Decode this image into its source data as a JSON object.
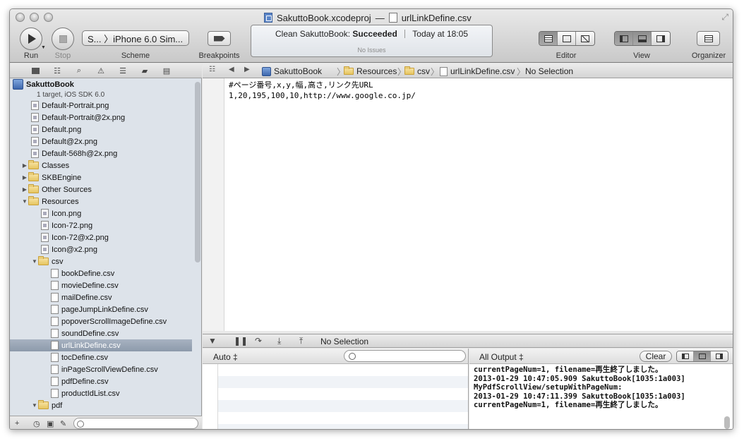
{
  "window": {
    "project_file": "SakuttoBook.xcodeproj",
    "title_separator": "—",
    "open_file": "urlLinkDefine.csv"
  },
  "toolbar": {
    "run_label": "Run",
    "stop_label": "Stop",
    "scheme_value": "S... 〉iPhone 6.0 Sim...",
    "scheme_label": "Scheme",
    "breakpoints_label": "Breakpoints",
    "editor_label": "Editor",
    "view_label": "View",
    "organizer_label": "Organizer"
  },
  "activity": {
    "action": "Clean SakuttoBook:",
    "result": "Succeeded",
    "time": "Today at 18:05",
    "issues": "No Issues"
  },
  "navigator": {
    "items": [
      {
        "label": "SakuttoBook",
        "type": "project",
        "indent": 0,
        "disclosure": "▼"
      },
      {
        "label": "1 target, iOS SDK 6.0",
        "type": "subtitle",
        "indent": 0,
        "disclosure": ""
      },
      {
        "label": "Default-Portrait.png",
        "type": "image",
        "indent": 1,
        "disclosure": ""
      },
      {
        "label": "Default-Portrait@2x.png",
        "type": "image",
        "indent": 1,
        "disclosure": ""
      },
      {
        "label": "Default.png",
        "type": "image",
        "indent": 1,
        "disclosure": ""
      },
      {
        "label": "Default@2x.png",
        "type": "image",
        "indent": 1,
        "disclosure": ""
      },
      {
        "label": "Default-568h@2x.png",
        "type": "image",
        "indent": 1,
        "disclosure": ""
      },
      {
        "label": "Classes",
        "type": "folder",
        "indent": 1,
        "disclosure": "▶"
      },
      {
        "label": "SKBEngine",
        "type": "folder",
        "indent": 1,
        "disclosure": "▶"
      },
      {
        "label": "Other Sources",
        "type": "folder",
        "indent": 1,
        "disclosure": "▶"
      },
      {
        "label": "Resources",
        "type": "folder",
        "indent": 1,
        "disclosure": "▼"
      },
      {
        "label": "Icon.png",
        "type": "image",
        "indent": 2,
        "disclosure": ""
      },
      {
        "label": "Icon-72.png",
        "type": "image",
        "indent": 2,
        "disclosure": ""
      },
      {
        "label": "Icon-72@x2.png",
        "type": "image",
        "indent": 2,
        "disclosure": ""
      },
      {
        "label": "Icon@x2.png",
        "type": "image",
        "indent": 2,
        "disclosure": ""
      },
      {
        "label": "csv",
        "type": "folder",
        "indent": 2,
        "disclosure": "▼"
      },
      {
        "label": "bookDefine.csv",
        "type": "file",
        "indent": 3,
        "disclosure": ""
      },
      {
        "label": "movieDefine.csv",
        "type": "file",
        "indent": 3,
        "disclosure": ""
      },
      {
        "label": "mailDefine.csv",
        "type": "file",
        "indent": 3,
        "disclosure": ""
      },
      {
        "label": "pageJumpLinkDefine.csv",
        "type": "file",
        "indent": 3,
        "disclosure": ""
      },
      {
        "label": "popoverScrollImageDefine.csv",
        "type": "file",
        "indent": 3,
        "disclosure": ""
      },
      {
        "label": "soundDefine.csv",
        "type": "file",
        "indent": 3,
        "disclosure": ""
      },
      {
        "label": "urlLinkDefine.csv",
        "type": "file",
        "indent": 3,
        "disclosure": "",
        "selected": true
      },
      {
        "label": "tocDefine.csv",
        "type": "file",
        "indent": 3,
        "disclosure": ""
      },
      {
        "label": "inPageScrollViewDefine.csv",
        "type": "file",
        "indent": 3,
        "disclosure": ""
      },
      {
        "label": "pdfDefine.csv",
        "type": "file",
        "indent": 3,
        "disclosure": ""
      },
      {
        "label": "productIdList.csv",
        "type": "file",
        "indent": 3,
        "disclosure": ""
      },
      {
        "label": "pdf",
        "type": "folder",
        "indent": 2,
        "disclosure": "▼"
      }
    ]
  },
  "jumpbar": {
    "crumbs": [
      "SakuttoBook",
      "Resources",
      "csv",
      "urlLinkDefine.csv",
      "No Selection"
    ]
  },
  "editor": {
    "lines": [
      "#ページ番号,x,y,幅,高さ,リンク先URL",
      "1,20,195,100,10,http://www.google.co.jp/"
    ]
  },
  "debug": {
    "status": "No Selection"
  },
  "variables": {
    "scope": "Auto ‡"
  },
  "console": {
    "filter": "All Output ‡",
    "clear_label": "Clear",
    "output": "currentPageNum=1, filename=再生終了しました。\n2013-01-29 10:47:05.909 SakuttoBook[1035:1a003]\nMyPdfScrollView/setupWithPageNum:\n2013-01-29 10:47:11.399 SakuttoBook[1035:1a003]\ncurrentPageNum=1, filename=再生終了しました。"
  },
  "icons": {
    "run": "play-icon",
    "stop": "stop-icon",
    "breakpoints": "breakpoint-icon",
    "organizer": "organizer-icon",
    "search": "search-icon"
  }
}
